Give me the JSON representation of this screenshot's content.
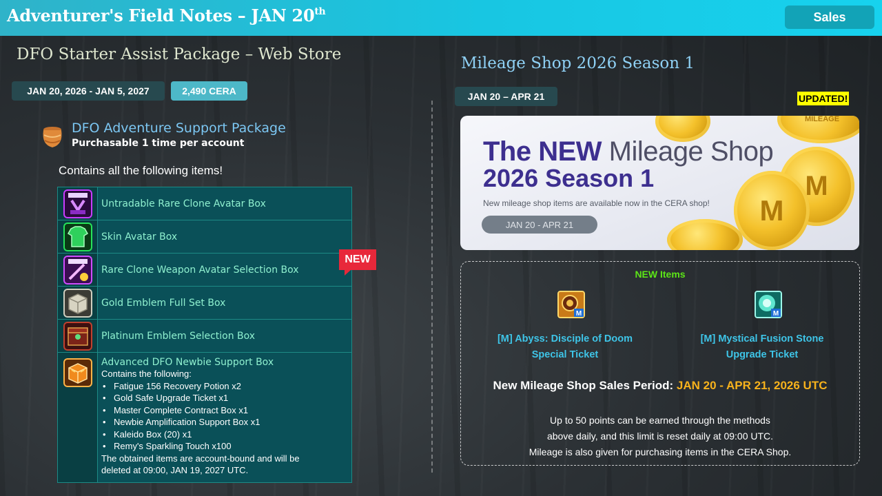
{
  "header": {
    "title": "Adventurer's Field Notes – JAN 20",
    "title_sup": "th",
    "sales_button": "Sales"
  },
  "left": {
    "title": "DFO Starter Assist Package – Web Store",
    "date_range": "JAN 20, 2026 -  JAN 5, 2027",
    "price": "2,490 CERA",
    "package_name": "DFO Adventure Support Package",
    "package_limit": "Purchasable 1 time per account",
    "contains_label": "Contains all the following items!",
    "new_badge": "NEW",
    "items": [
      {
        "name": "Untradable Rare Clone Avatar Box",
        "icon": "clone-avatar-box-icon"
      },
      {
        "name": "Skin Avatar Box",
        "icon": "skin-avatar-box-icon"
      },
      {
        "name": "Rare Clone Weapon Avatar Selection Box",
        "icon": "clone-weapon-box-icon"
      },
      {
        "name": "Gold Emblem Full Set Box",
        "icon": "gold-emblem-box-icon"
      },
      {
        "name": "Platinum Emblem Selection Box",
        "icon": "platinum-emblem-box-icon"
      }
    ],
    "advanced_box": {
      "name": "Advanced DFO Newbie Support Box",
      "intro": "Contains the following:",
      "contents": [
        "Fatigue 156 Recovery Potion x2",
        "Gold Safe Upgrade Ticket x1",
        "Master Complete Contract Box x1",
        "Newbie Amplification Support Box x1",
        "Kaleido Box (20) x1",
        "Remy's Sparkling Touch x100"
      ],
      "note_line1": "The obtained items are account-bound and will be",
      "note_line2": "deleted at 09:00, JAN 19, 2027 UTC."
    }
  },
  "right": {
    "title": "Mileage Shop 2026 Season 1",
    "date_range": "JAN 20 –  APR 21",
    "updated_badge": "UPDATED!",
    "banner": {
      "line1_bold": "The NEW",
      "line1_thin": "Mileage Shop",
      "line2": "2026 Season 1",
      "description": "New mileage shop items are available now in the CERA shop!",
      "date": "JAN 20 - APR 21",
      "coin_mark": "M",
      "coin_text": "MILEAGE"
    },
    "new_items_title": "NEW Items",
    "new_items": [
      {
        "line1": "[M] Abyss: Disciple of Doom",
        "line2": "Special Ticket",
        "icon": "abyss-ticket-icon"
      },
      {
        "line1": "[M] Mystical Fusion Stone",
        "line2": "Upgrade Ticket",
        "icon": "fusion-stone-ticket-icon"
      }
    ],
    "sales_period_label": "New Mileage Shop Sales Period: ",
    "sales_period_date": "JAN 20 - APR 21, 2026 UTC",
    "notes": [
      "Up to 50 points can be earned through the methods",
      "above daily, and this limit is reset daily at 09:00 UTC.",
      "Mileage is also given for purchasing items in the CERA Shop."
    ]
  },
  "colors": {
    "header": "#18c6e2",
    "accent_blue": "#7cc7f3",
    "item_text": "#8ff0cf",
    "new_items_green": "#5ce617",
    "period_gold": "#f7b21c",
    "badge_red": "#e8283a",
    "updated_yellow": "#ffff00"
  }
}
